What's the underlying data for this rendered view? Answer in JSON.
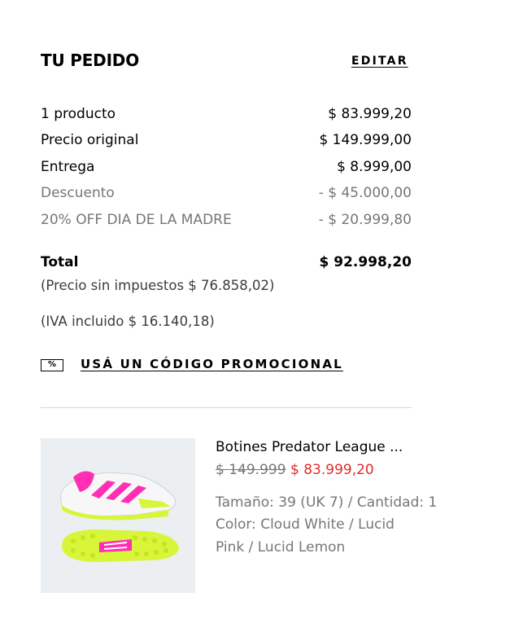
{
  "order": {
    "title": "TU PEDIDO",
    "edit_label": "EDITAR",
    "lines": [
      {
        "label": "1 producto",
        "value": "$ 83.999,20",
        "muted": false
      },
      {
        "label": "Precio original",
        "value": "$ 149.999,00",
        "muted": false
      },
      {
        "label": "Entrega",
        "value": "$ 8.999,00",
        "muted": false
      },
      {
        "label": "Descuento",
        "value": "- $ 45.000,00",
        "muted": true
      },
      {
        "label": "20% OFF DIA DE LA MADRE",
        "value": "- $ 20.999,80",
        "muted": true
      }
    ],
    "total_label": "Total",
    "total_value": "$ 92.998,20",
    "tax_free_note": "(Precio sin impuestos  $ 76.858,02)",
    "vat_note": "(IVA incluido  $ 16.140,18)"
  },
  "promo": {
    "icon_text": "%",
    "label": "USÁ UN CÓDIGO PROMOCIONAL"
  },
  "product": {
    "name": "Botines Predator League ...",
    "original_price": "$ 149.999",
    "sale_price": "$ 83.999,20",
    "size_qty": "Tamaño: 39 (UK 7) / Cantidad: 1",
    "color_line1": "Color: Cloud White / Lucid",
    "color_line2": "Pink / Lucid Lemon",
    "image_icon": "football-boot-icon",
    "colors": {
      "white": "#f7f7f7",
      "pink": "#ff2fb4",
      "lemon": "#d8f53a",
      "sale": "#e32b2b"
    }
  }
}
